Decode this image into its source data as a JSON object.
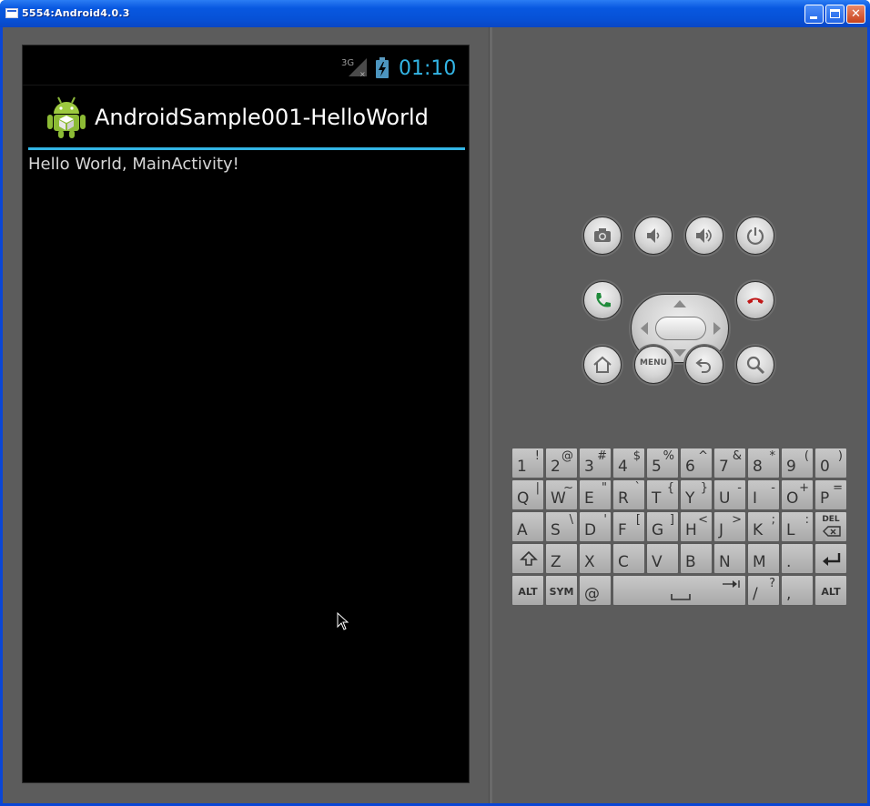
{
  "window": {
    "title": "5554:Android4.0.3"
  },
  "device": {
    "status_bar": {
      "network": "3G",
      "clock": "01:10"
    },
    "action_bar": {
      "app_title": "AndroidSample001-HelloWorld"
    },
    "content": {
      "text": "Hello World, MainActivity!"
    }
  },
  "controls": {
    "menu_label": "MENU"
  },
  "keyboard": {
    "rows": [
      [
        {
          "main": "1",
          "alt": "!"
        },
        {
          "main": "2",
          "alt": "@"
        },
        {
          "main": "3",
          "alt": "#"
        },
        {
          "main": "4",
          "alt": "$"
        },
        {
          "main": "5",
          "alt": "%"
        },
        {
          "main": "6",
          "alt": "^"
        },
        {
          "main": "7",
          "alt": "&"
        },
        {
          "main": "8",
          "alt": "*"
        },
        {
          "main": "9",
          "alt": "("
        },
        {
          "main": "0",
          "alt": ")"
        }
      ],
      [
        {
          "main": "Q",
          "alt": "|"
        },
        {
          "main": "W",
          "alt": "~"
        },
        {
          "main": "E",
          "alt": "\""
        },
        {
          "main": "R",
          "alt": "`"
        },
        {
          "main": "T",
          "alt": "{"
        },
        {
          "main": "Y",
          "alt": "}"
        },
        {
          "main": "U",
          "alt": "-"
        },
        {
          "main": "I",
          "alt": "-"
        },
        {
          "main": "O",
          "alt": "+"
        },
        {
          "main": "P",
          "alt": "="
        }
      ],
      [
        {
          "main": "A",
          "alt": ""
        },
        {
          "main": "S",
          "alt": "\\"
        },
        {
          "main": "D",
          "alt": "'"
        },
        {
          "main": "F",
          "alt": "["
        },
        {
          "main": "G",
          "alt": "]"
        },
        {
          "main": "H",
          "alt": "<"
        },
        {
          "main": "J",
          "alt": ">"
        },
        {
          "main": "K",
          "alt": ";"
        },
        {
          "main": "L",
          "alt": ":"
        }
      ],
      [
        {
          "main": "Z",
          "alt": ""
        },
        {
          "main": "X",
          "alt": ""
        },
        {
          "main": "C",
          "alt": ""
        },
        {
          "main": "V",
          "alt": ""
        },
        {
          "main": "B",
          "alt": ""
        },
        {
          "main": "N",
          "alt": ""
        },
        {
          "main": "M",
          "alt": ""
        },
        {
          "main": ".",
          "alt": ""
        }
      ],
      [
        {
          "main": "@",
          "alt": ""
        },
        {
          "main": "/",
          "alt": "?"
        },
        {
          "main": ",",
          "alt": ""
        }
      ]
    ],
    "del_label": "DEL",
    "alt_label": "ALT",
    "sym_label": "SYM"
  }
}
